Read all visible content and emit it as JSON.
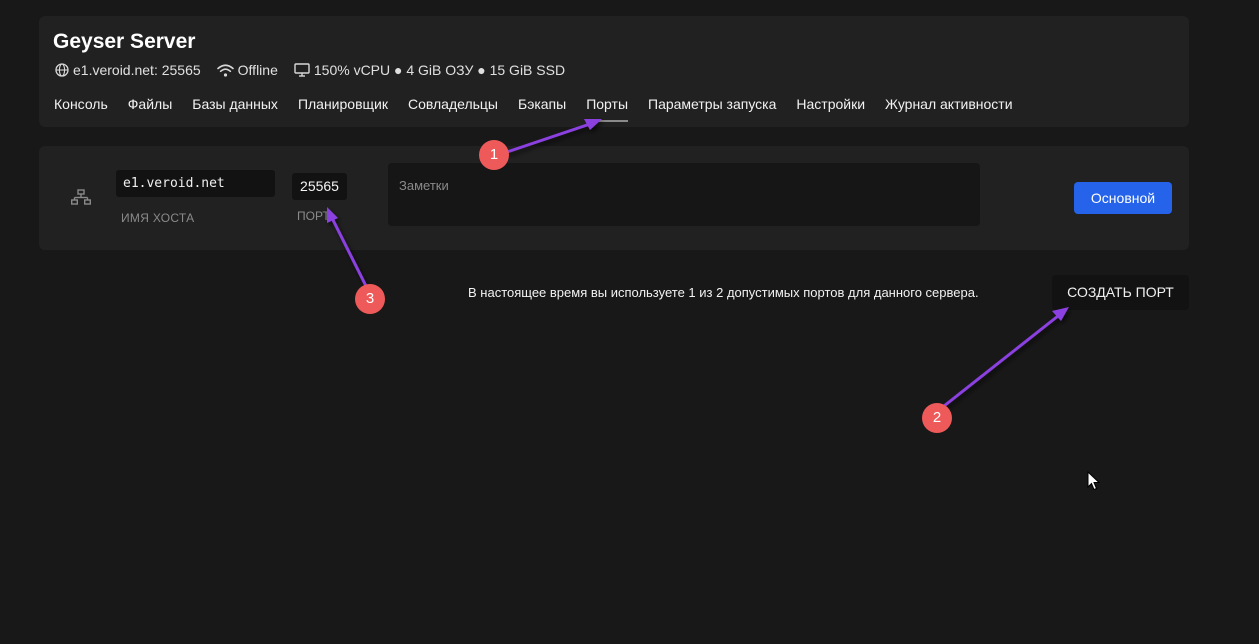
{
  "server": {
    "title": "Geyser Server",
    "address": "e1.veroid.net: 25565",
    "status": "Offline",
    "resources": "150% vCPU ● 4 GiB ОЗУ ● 15 GiB SSD"
  },
  "nav": {
    "tabs": [
      {
        "label": "Консоль"
      },
      {
        "label": "Файлы"
      },
      {
        "label": "Базы данных"
      },
      {
        "label": "Планировщик"
      },
      {
        "label": "Совладельцы"
      },
      {
        "label": "Бэкапы"
      },
      {
        "label": "Порты",
        "active": true
      },
      {
        "label": "Параметры запуска"
      },
      {
        "label": "Настройки"
      },
      {
        "label": "Журнал активности"
      }
    ]
  },
  "allocation": {
    "hostname": "e1.veroid.net",
    "hostname_label": "ИМЯ ХОСТА",
    "port": "25565",
    "port_label": "ПОРТ",
    "notes_placeholder": "Заметки",
    "primary_label": "Основной"
  },
  "footer": {
    "usage_text": "В настоящее время вы используете 1 из 2 допустимых портов для данного сервера.",
    "create_label": "СОЗДАТЬ ПОРТ"
  },
  "annotations": {
    "callout_1": "1",
    "callout_2": "2",
    "callout_3": "3"
  },
  "colors": {
    "background": "#181818",
    "card": "#212121",
    "primary": "#2563eb",
    "callout": "#ee5a5a",
    "arrow": "#8b3fe0"
  },
  "icons": [
    "globe-icon",
    "wifi-icon",
    "monitor-icon",
    "network-icon",
    "cursor-icon"
  ]
}
